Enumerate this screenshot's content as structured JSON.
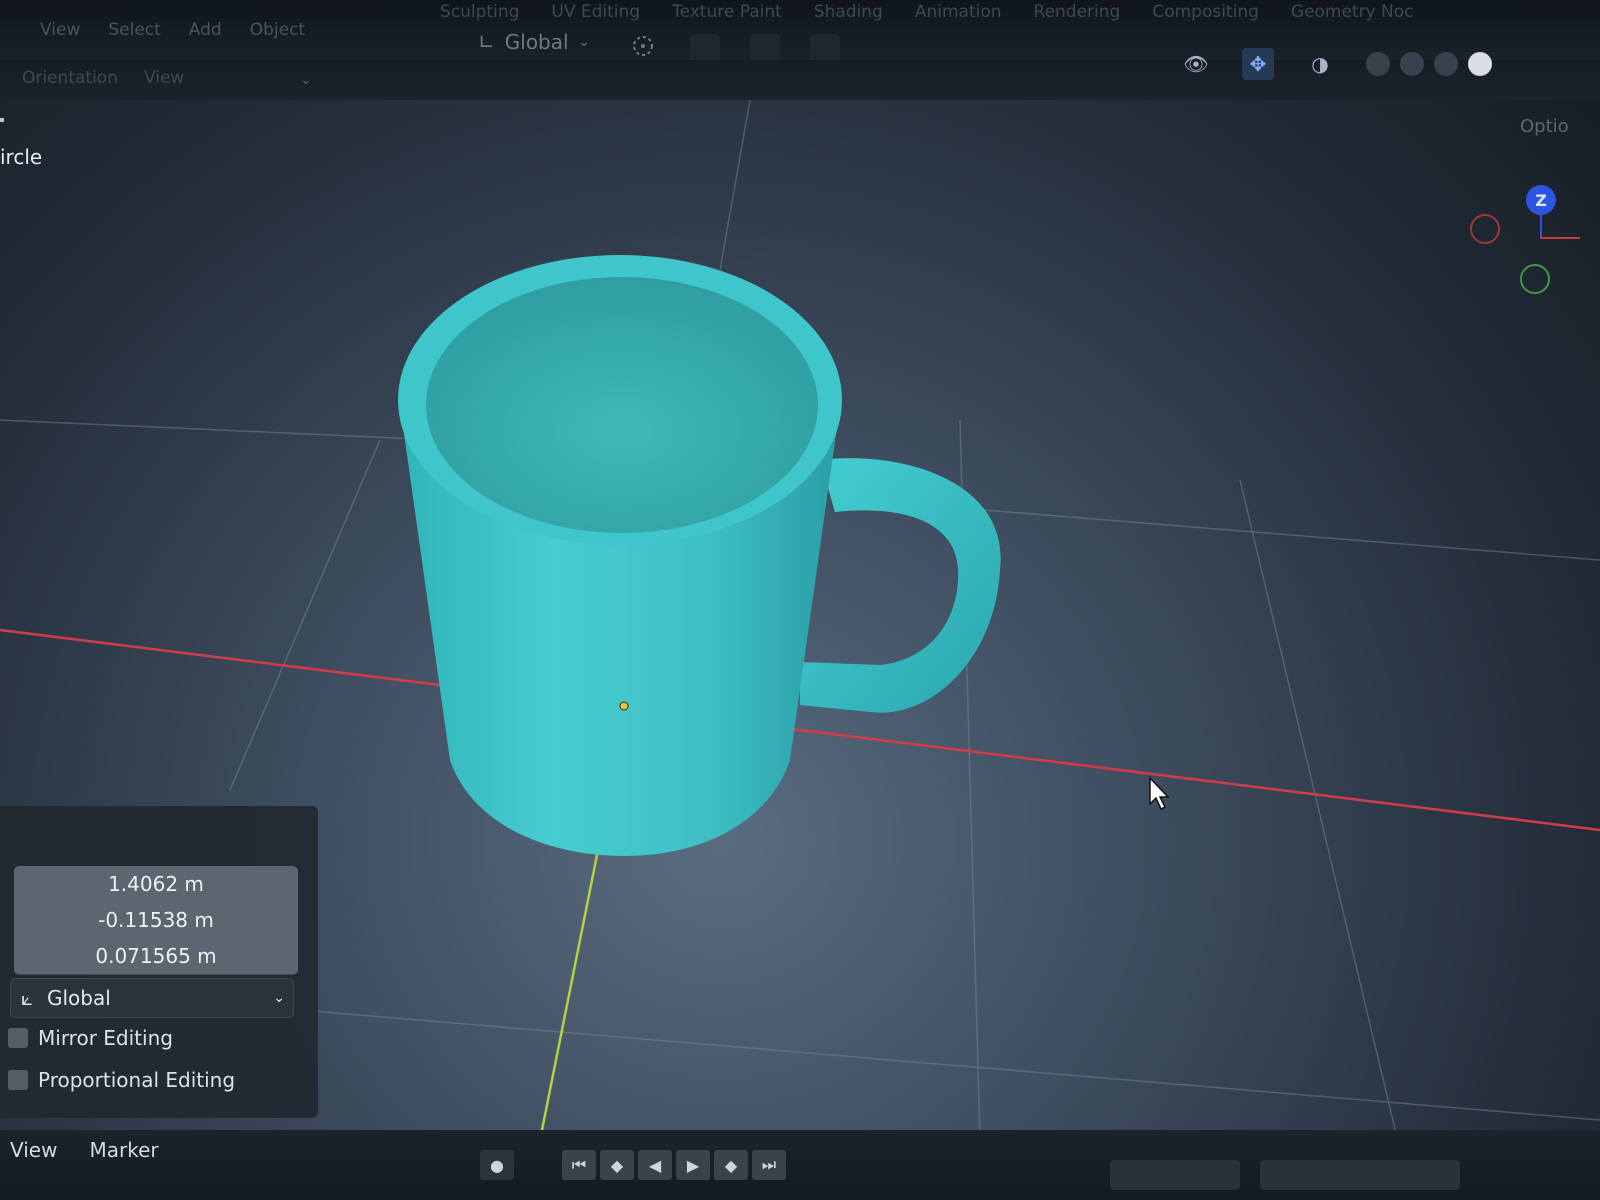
{
  "workspace_tabs": [
    "Sculpting",
    "UV Editing",
    "Texture Paint",
    "Shading",
    "Animation",
    "Rendering",
    "Compositing",
    "Geometry Noc"
  ],
  "menubar": [
    "View",
    "Select",
    "Add",
    "Object"
  ],
  "subheader": {
    "orientation_label": "Orientation",
    "view_label": "View"
  },
  "header": {
    "transform_orientation": "Global"
  },
  "right_header": {
    "options_label": "Optio"
  },
  "viewport": {
    "object_label": "ircle",
    "gizmo_z_label": "Z"
  },
  "colors": {
    "mug": "#3cc8c8",
    "x_axis": "#d23c48",
    "y_axis": "#b4d23c",
    "gizmo_z": "#2b55e0"
  },
  "redo_panel": {
    "values": [
      "1.4062 m",
      "-0.11538 m",
      "0.071565 m"
    ],
    "orientation": "Global",
    "mirror_editing_label": "Mirror Editing",
    "proportional_editing_label": "Proportional Editing"
  },
  "timeline": {
    "menu": [
      "View",
      "Marker"
    ]
  },
  "icons": {
    "pivot": "pivot-icon",
    "visibility": "eye-icon",
    "gizmo": "gizmo-icon",
    "overlay": "overlay-icon",
    "jump_start": "jump-start-icon",
    "prev_key": "prev-keyframe-icon",
    "play_reverse": "play-reverse-icon",
    "play": "play-icon",
    "next_key": "next-keyframe-icon",
    "jump_end": "jump-end-icon",
    "record": "record-icon"
  }
}
